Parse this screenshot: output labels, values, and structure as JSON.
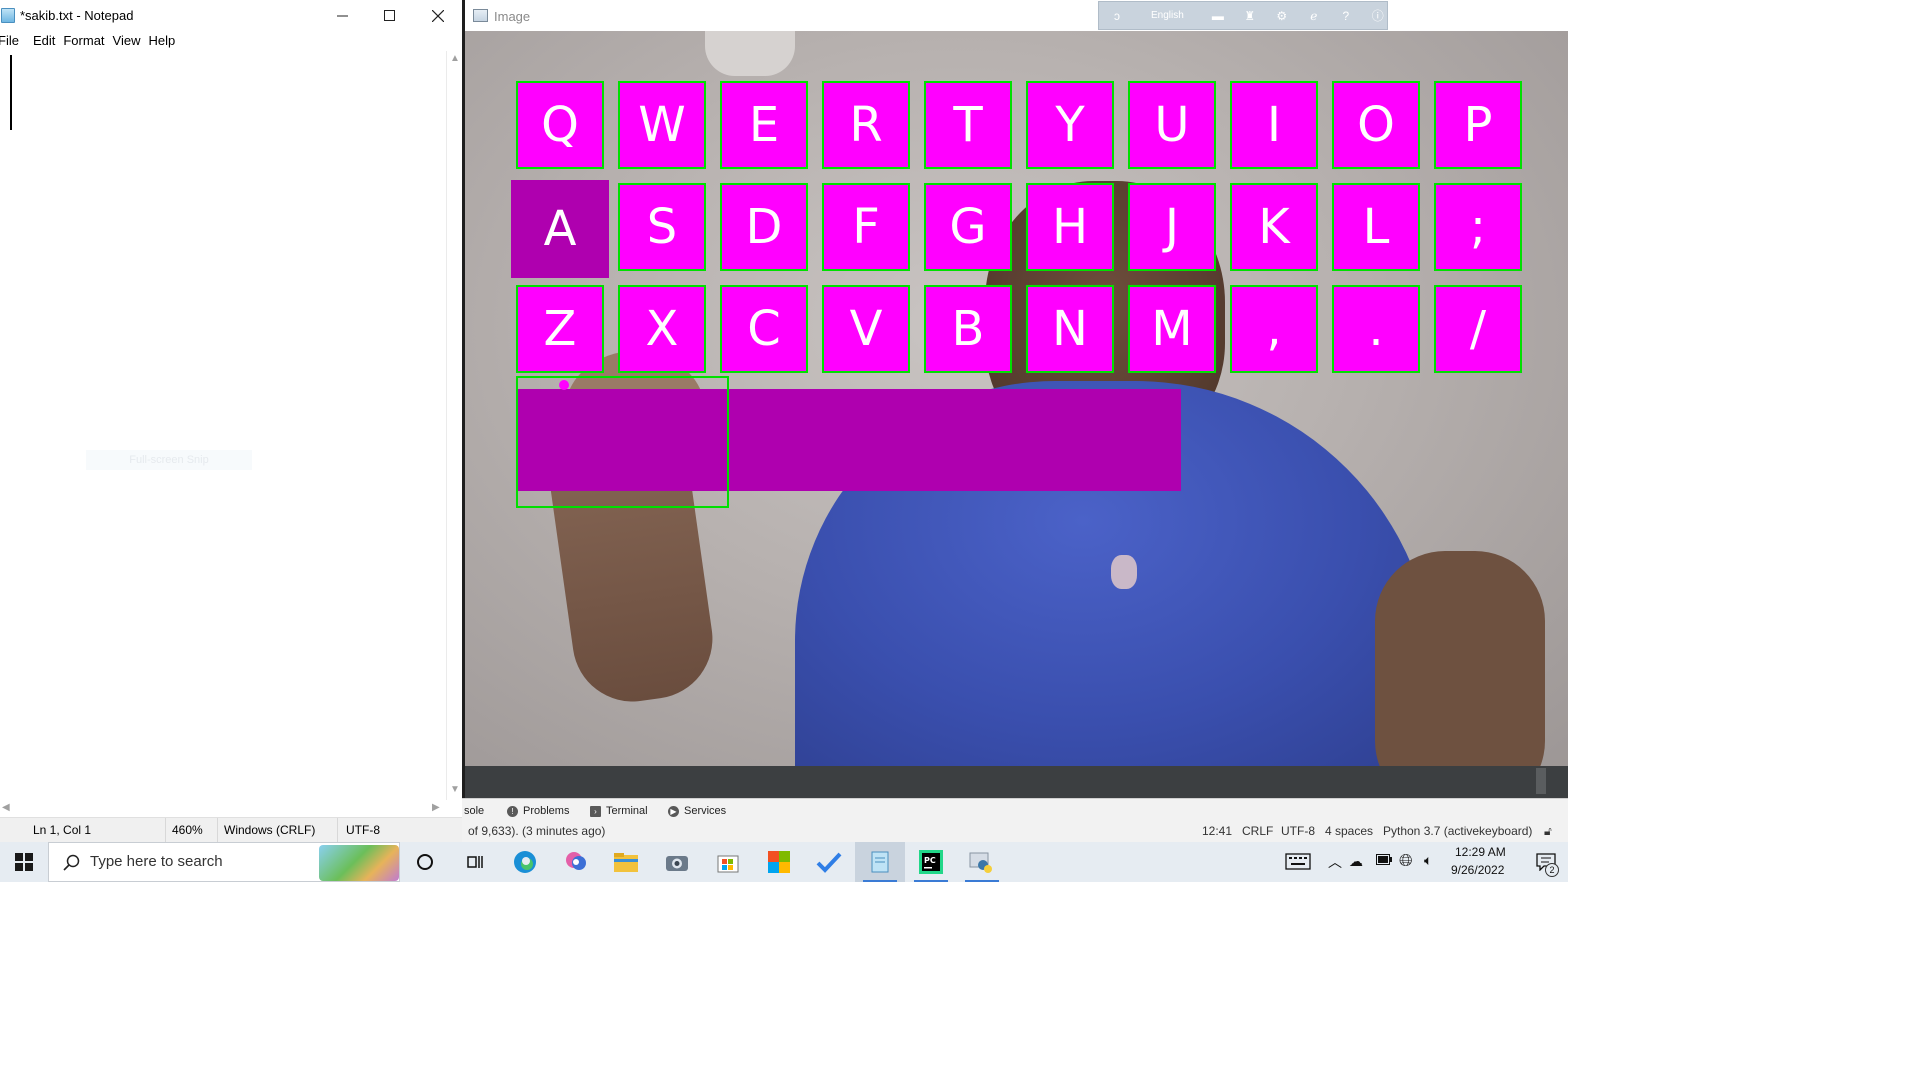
{
  "notepad": {
    "title": "*sakib.txt - Notepad",
    "menu": [
      "File",
      "Edit",
      "Format",
      "View",
      "Help"
    ],
    "status": {
      "position": "Ln 1, Col 1",
      "zoom": "460%",
      "line_endings": "Windows (CRLF)",
      "encoding": "UTF-8"
    },
    "snip_hint": "Full-screen Snip"
  },
  "image_window": {
    "title": "Image",
    "ime_language": "English",
    "keyboard_rows": [
      [
        "Q",
        "W",
        "E",
        "R",
        "T",
        "Y",
        "U",
        "I",
        "O",
        "P"
      ],
      [
        "A",
        "S",
        "D",
        "F",
        "G",
        "H",
        "J",
        "K",
        "L",
        ";"
      ],
      [
        "Z",
        "X",
        "C",
        "V",
        "B",
        "N",
        "M",
        ",",
        ".",
        "/"
      ]
    ],
    "pressed_key": "A",
    "typed_text": "",
    "colors": {
      "key": "#ff00ff",
      "key_pressed": "#af00af",
      "key_border": "#00e000",
      "text_box": "#af00af"
    }
  },
  "ide": {
    "tabs": [
      {
        "label": "sole",
        "icon": ""
      },
      {
        "label": "Problems",
        "icon": "alert-icon"
      },
      {
        "label": "Terminal",
        "icon": "terminal-icon"
      },
      {
        "label": "Services",
        "icon": "play-icon"
      }
    ],
    "status_left": "of 9,633). (3 minutes ago)",
    "status_right": {
      "position": "12:41",
      "line_sep": "CRLF",
      "encoding": "UTF-8",
      "indent": "4 spaces",
      "interpreter": "Python 3.7 (activekeyboard)"
    }
  },
  "taskbar": {
    "search_placeholder": "Type here to search",
    "apps": [
      "cortana-icon",
      "task-view-icon",
      "edge-icon",
      "snip-icon",
      "file-explorer-icon",
      "camera-icon",
      "store-icon",
      "office-icon",
      "todo-icon",
      "notepad-icon",
      "pycharm-icon",
      "python-icon"
    ],
    "active_apps": [
      "notepad-icon",
      "pycharm-icon",
      "python-icon"
    ],
    "time": "12:29 AM",
    "date": "9/26/2022",
    "notification_count": "2"
  }
}
